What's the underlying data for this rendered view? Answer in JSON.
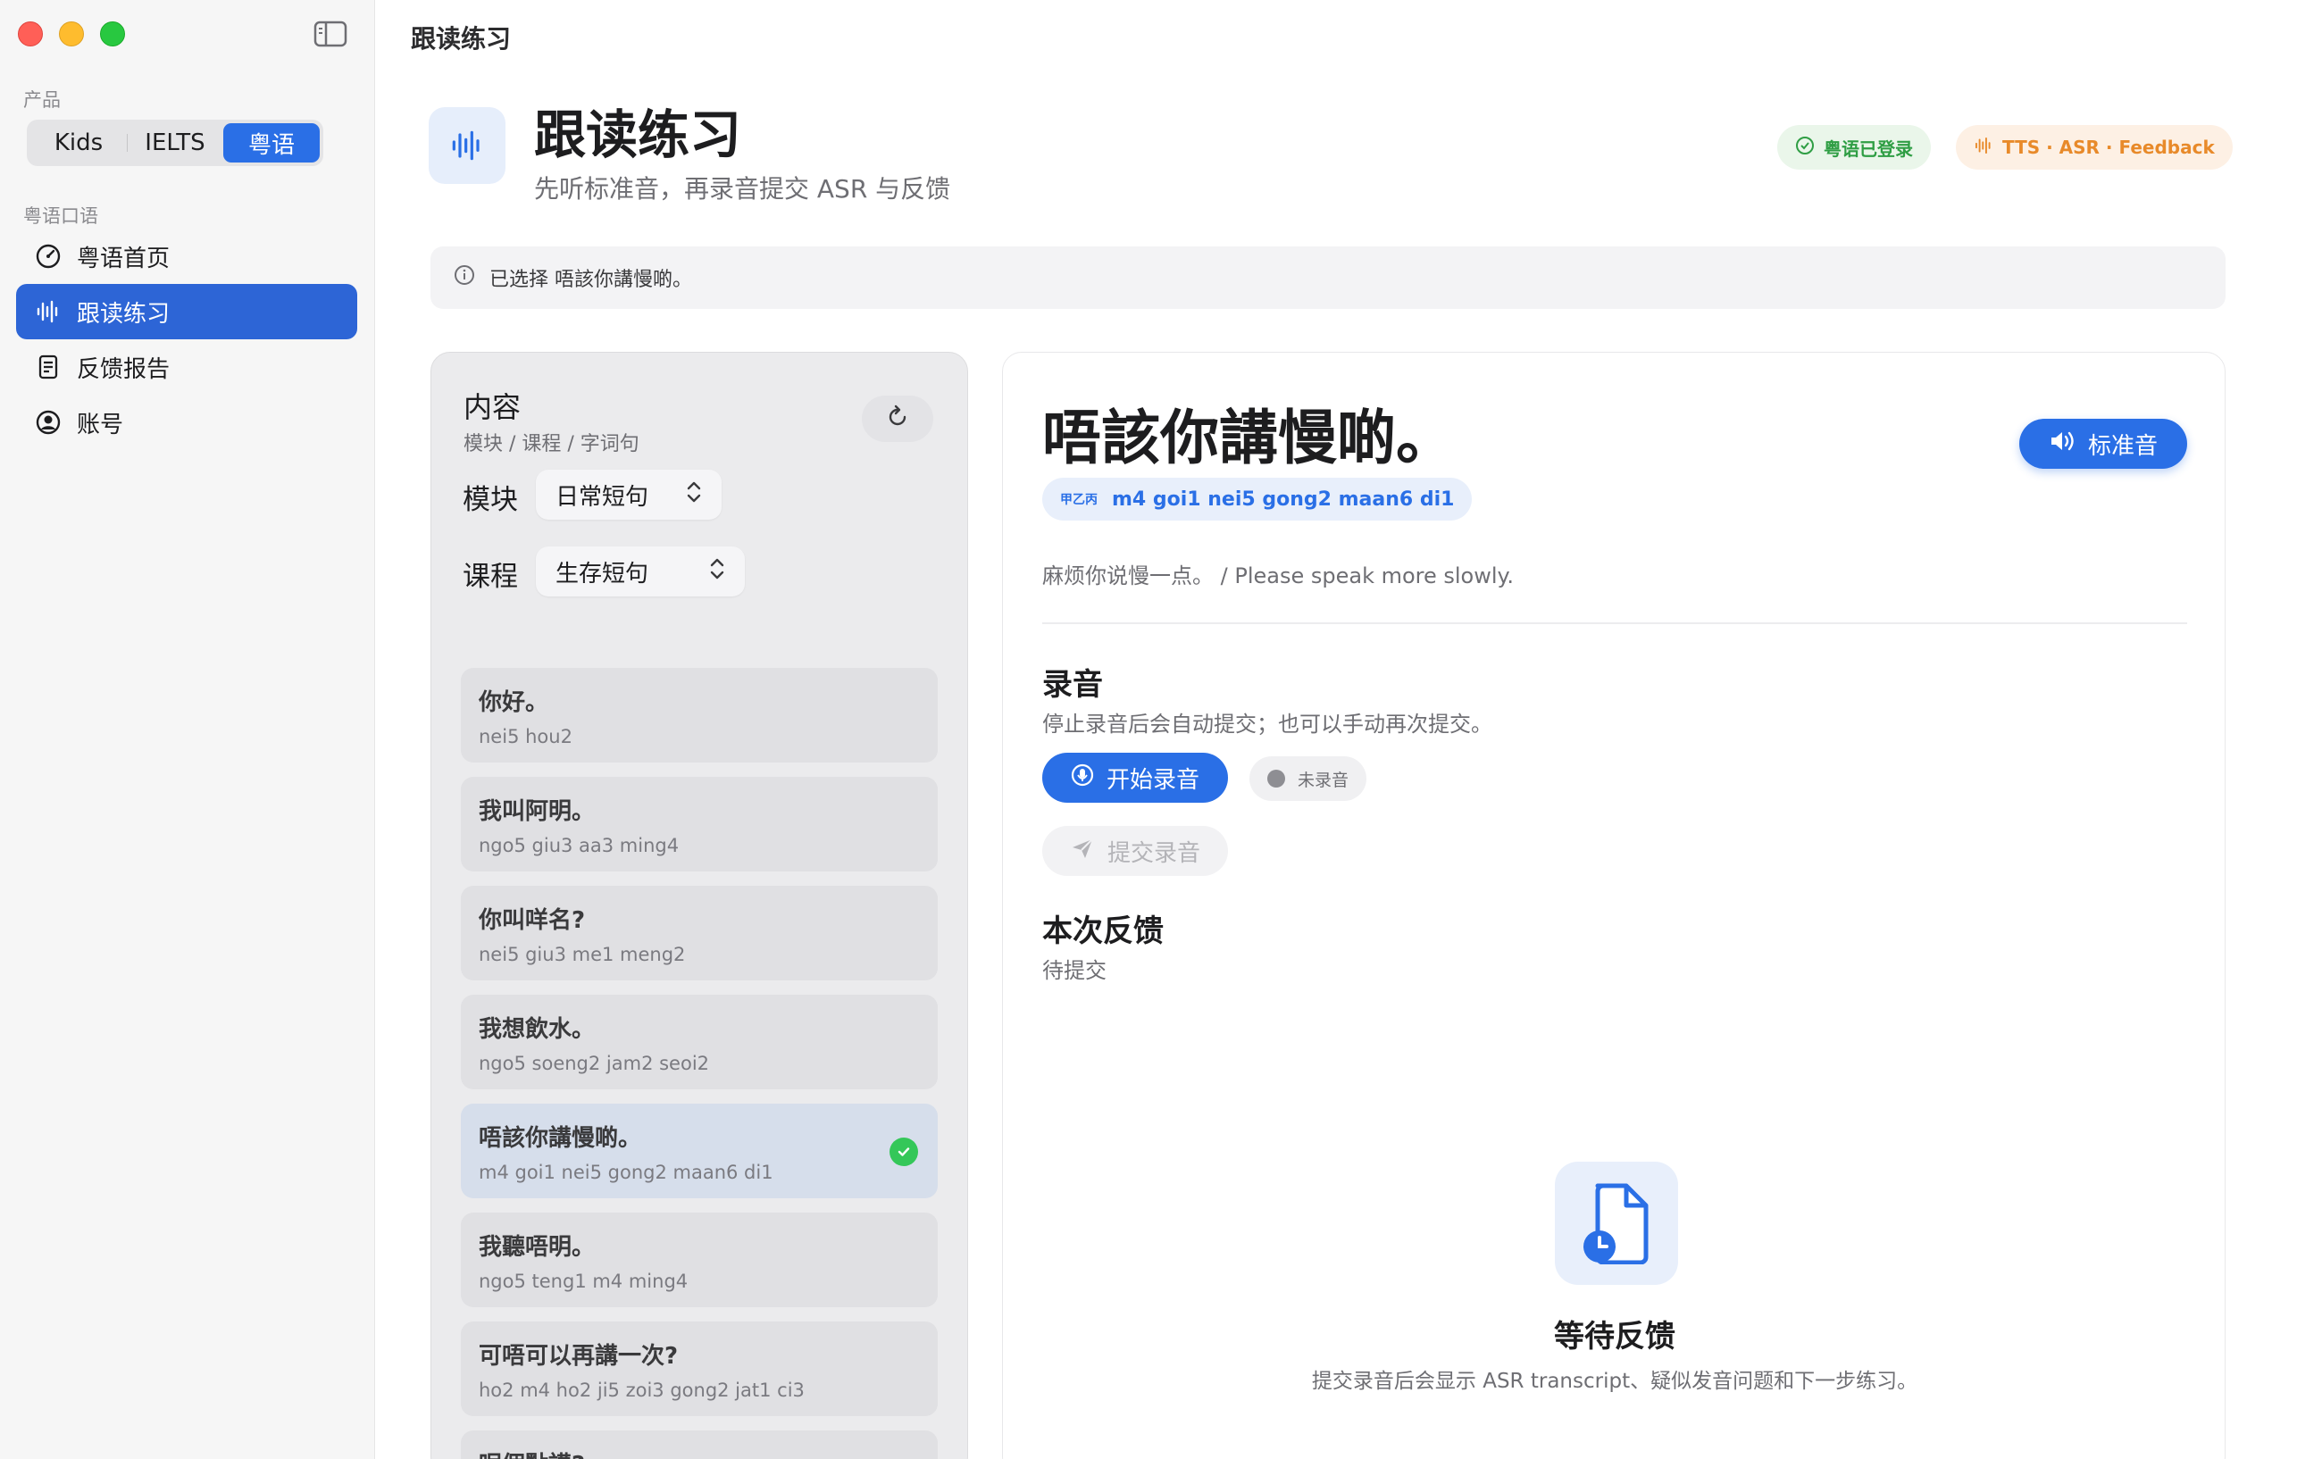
{
  "window": {
    "title": "跟读练习"
  },
  "sidebar": {
    "product_label": "产品",
    "products": [
      "Kids",
      "IELTS",
      "粤语"
    ],
    "active_product": "粤语",
    "section_label": "粤语口语",
    "items": [
      {
        "label": "粤语首页",
        "icon": "gauge-icon"
      },
      {
        "label": "跟读练习",
        "icon": "waveform-icon",
        "active": true
      },
      {
        "label": "反馈报告",
        "icon": "report-icon"
      },
      {
        "label": "账号",
        "icon": "account-icon"
      }
    ]
  },
  "header": {
    "title": "跟读练习",
    "subtitle": "先听标准音，再录音提交 ASR 与反馈",
    "badge_login": "粤语已登录",
    "badge_features": "TTS · ASR · Feedback"
  },
  "info_bar": {
    "text": "已选择 唔該你講慢啲。"
  },
  "content_panel": {
    "title": "内容",
    "subtitle": "模块 / 课程 / 字词句",
    "module_label": "模块",
    "module_value": "日常短句",
    "course_label": "课程",
    "course_value": "生存短句",
    "phrases": [
      {
        "text": "你好。",
        "jyutping": "nei5 hou2"
      },
      {
        "text": "我叫阿明。",
        "jyutping": "ngo5 giu3 aa3 ming4"
      },
      {
        "text": "你叫咩名?",
        "jyutping": "nei5 giu3 me1 meng2"
      },
      {
        "text": "我想飲水。",
        "jyutping": "ngo5 soeng2 jam2 seoi2"
      },
      {
        "text": "唔該你講慢啲。",
        "jyutping": "m4 goi1 nei5 gong2 maan6 di1",
        "selected": true
      },
      {
        "text": "我聽唔明。",
        "jyutping": "ngo5 teng1 m4 ming4"
      },
      {
        "text": "可唔可以再講一次?",
        "jyutping": "ho2 m4 ho2 ji5 zoi3 gong2 jat1 ci3"
      },
      {
        "text": "呢個點講?",
        "jyutping": ""
      }
    ]
  },
  "practice": {
    "phrase": "唔該你講慢啲。",
    "play_label": "标准音",
    "jyutping_tag": "甲乙丙",
    "jyutping": "m4 goi1 nei5 gong2 maan6 di1",
    "translation": "麻烦你说慢一点。 / Please speak more slowly.",
    "record_title": "录音",
    "record_sub": "停止录音后会自动提交；也可以手动再次提交。",
    "record_button": "开始录音",
    "record_status": "未录音",
    "submit_button": "提交录音",
    "feedback_title": "本次反馈",
    "feedback_status": "待提交",
    "empty_title": "等待反馈",
    "empty_sub": "提交录音后会显示 ASR transcript、疑似发音问题和下一步练习。"
  },
  "colors": {
    "accent": "#2a6fe6",
    "success": "#34c759",
    "warning": "#e88a2a"
  }
}
